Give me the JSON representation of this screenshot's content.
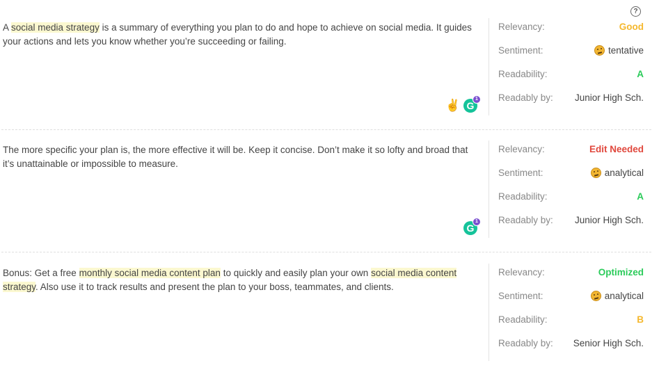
{
  "help_icon": "question-circle-icon",
  "colors": {
    "good": "#f5b82e",
    "edit_needed": "#e0473c",
    "optimized": "#2bcb5a",
    "grade_a": "#2bcb5a",
    "grade_b": "#f5b82e",
    "highlight": "#fbf8d0",
    "grammarly": "#15c39a",
    "grammarly_badge": "#7a4fd0"
  },
  "labels": {
    "relevancy": "Relevancy:",
    "sentiment": "Sentiment:",
    "readability": "Readability:",
    "readably_by": "Readably by:"
  },
  "blocks": [
    {
      "segments": [
        {
          "text": "A ",
          "highlight": false
        },
        {
          "text": "social media strategy",
          "highlight": true
        },
        {
          "text": " is a summary of everything you plan to do and hope to achieve on social media. It guides your actions and lets you know whether you’re succeeding or failing.",
          "highlight": false
        }
      ],
      "relevancy": "Good",
      "relevancy_color": "#f5b82e",
      "sentiment": "tentative",
      "sentiment_icon": "thinking-face-icon",
      "readability": "A",
      "readability_color": "#2bcb5a",
      "readably_by": "Junior High Sch.",
      "icons": [
        "victory-hand-icon",
        "grammarly-icon"
      ],
      "grammarly_badge": "1"
    },
    {
      "segments": [
        {
          "text": "The more specific your plan is, the more effective it will be. Keep it concise. Don’t make it so lofty and broad that it’s unattainable or impossible to measure.",
          "highlight": false
        }
      ],
      "relevancy": "Edit Needed",
      "relevancy_color": "#e0473c",
      "sentiment": "analytical",
      "sentiment_icon": "thinking-face-icon",
      "readability": "A",
      "readability_color": "#2bcb5a",
      "readably_by": "Junior High Sch.",
      "icons": [
        "grammarly-icon"
      ],
      "grammarly_badge": "1"
    },
    {
      "segments": [
        {
          "text": "Bonus: Get a free ",
          "highlight": false
        },
        {
          "text": "monthly social media content plan",
          "highlight": true
        },
        {
          "text": " to quickly and easily plan your own ",
          "highlight": false
        },
        {
          "text": "social media content strategy",
          "highlight": true
        },
        {
          "text": ". Also use it to track results and present the plan to your boss, teammates, and clients.",
          "highlight": false
        }
      ],
      "relevancy": "Optimized",
      "relevancy_color": "#2bcb5a",
      "sentiment": "analytical",
      "sentiment_icon": "thinking-face-icon",
      "readability": "B",
      "readability_color": "#f5b82e",
      "readably_by": "Senior High Sch."
    }
  ],
  "grammarly_letter": "G",
  "help_glyph": "?"
}
